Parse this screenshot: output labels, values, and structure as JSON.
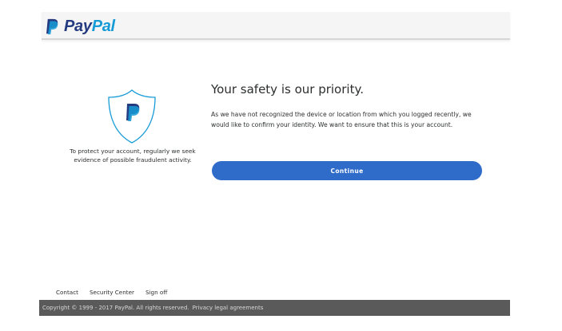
{
  "header": {
    "logo_pay": "Pay",
    "logo_pal": "Pal"
  },
  "left_panel": {
    "shield_icon": "paypal-shield-icon",
    "protect_text": "To protect your account, regularly we seek evidence of possible fraudulent activity."
  },
  "main": {
    "title": "Your safety is our priority.",
    "body": "As we have not recognized the device or location from which you logged recently, we would like to confirm your identity. We want to ensure that this is your account.",
    "continue_label": "Continue"
  },
  "footer": {
    "links": [
      "Contact",
      "Security Center",
      "Sign off"
    ],
    "copyright": "Copyright © 1999 - 2017 PayPal. All rights reserved.",
    "legal": "Privacy legal agreements"
  },
  "colors": {
    "brand_dark": "#253b80",
    "brand_light": "#179bd7",
    "button": "#2f6bc9",
    "footer_bar": "#5a5a5a"
  }
}
